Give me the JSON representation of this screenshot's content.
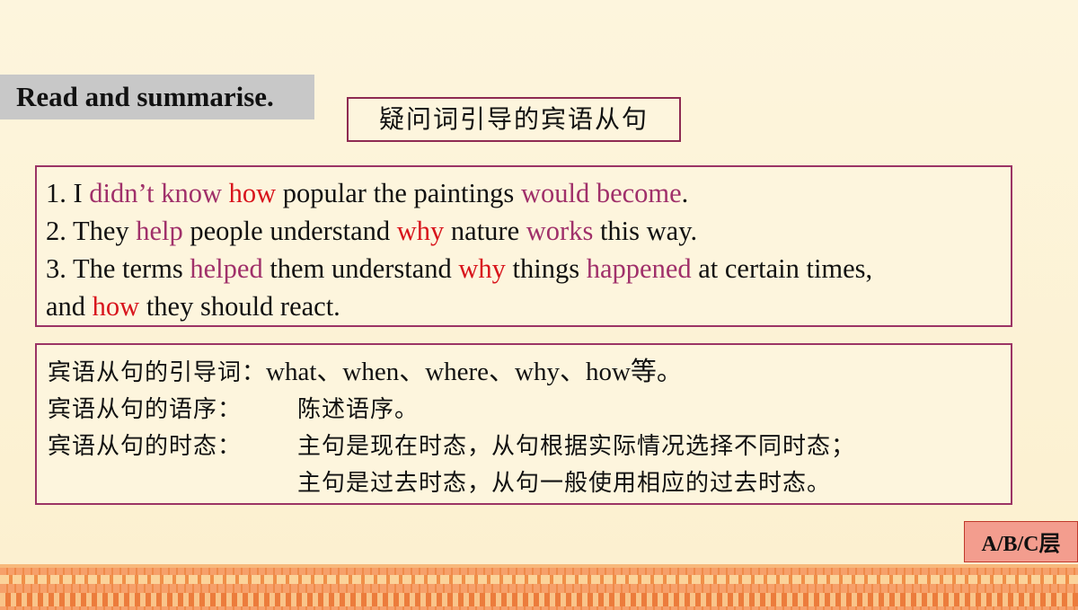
{
  "header": {
    "section_label": "Read and summarise.",
    "topic_title": "疑问词引导的宾语从句"
  },
  "examples": [
    {
      "num": "1. I ",
      "verb": "didn’t know",
      "gap1": " ",
      "conj": "how",
      "mid": " popular the paintings ",
      "verb2": "would become",
      "tail": "."
    },
    {
      "num": "2. They ",
      "verb": "help",
      "gap1": " people understand ",
      "conj": "why",
      "mid": " nature ",
      "verb2": "works",
      "tail": " this way."
    },
    {
      "num": "3. The terms ",
      "verb": "helped",
      "gap1": " them understand ",
      "conj": "why",
      "mid": " things ",
      "verb2": "happened",
      "tail": " at certain times,"
    },
    {
      "pre": "and ",
      "conj": "how",
      "tail": " they should react."
    }
  ],
  "rules": {
    "connectives_label": "宾语从句的引导词：",
    "connectives_value": "what、when、where、why、how等。",
    "order_label": "宾语从句的语序：",
    "order_value": "陈述语序。",
    "tense_label": "宾语从句的时态：",
    "tense_value_1": "主句是现在时态，从句根据实际情况选择不同时态；",
    "tense_value_2": "主句是过去时态，从句一般使用相应的过去时态。"
  },
  "badge": {
    "level": "A/B/C层"
  },
  "colors": {
    "verb_highlight": "#a0306a",
    "conjunction_highlight": "#d8141c",
    "box_border": "#9b3465",
    "background": "#fdf3d6"
  }
}
